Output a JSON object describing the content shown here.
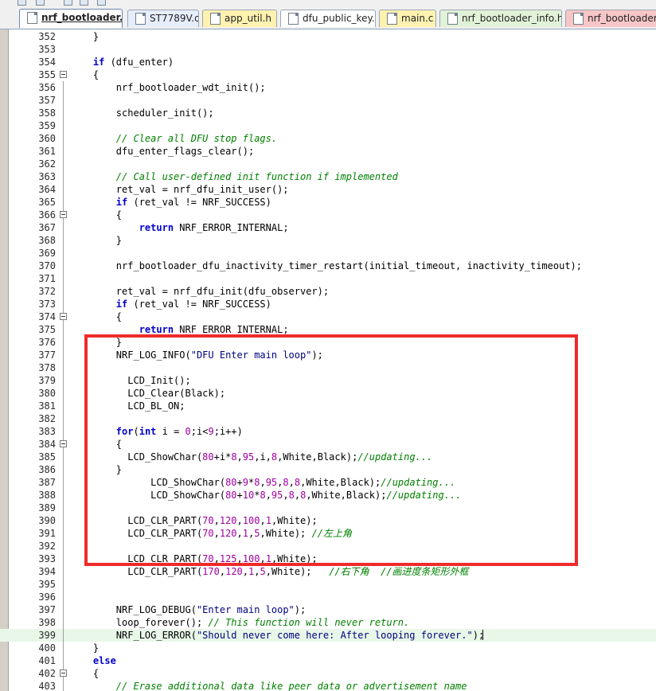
{
  "toolbar": {
    "icons": [
      "build-icon",
      "save-icon",
      "download-icon",
      "debug-icon",
      "check-icon"
    ]
  },
  "tabs": [
    {
      "label": "nrf_bootloader.c*",
      "active": true,
      "color": "#ffffff"
    },
    {
      "label": "ST7789V.c",
      "active": false,
      "color": "#e6eefc"
    },
    {
      "label": "app_util.h",
      "active": false,
      "color": "#fff2b0"
    },
    {
      "label": "dfu_public_key.c",
      "active": false,
      "color": "#ffffff"
    },
    {
      "label": "main.c",
      "active": false,
      "color": "#fff2b0"
    },
    {
      "label": "nrf_bootloader_info.h",
      "active": false,
      "color": "#e2f2d8"
    },
    {
      "label": "nrf_bootloader_a",
      "active": false,
      "color": "#f7c6c6"
    }
  ],
  "editor": {
    "highlighted_line": 399,
    "lines": [
      {
        "n": "352",
        "code": "    }"
      },
      {
        "n": "353",
        "code": ""
      },
      {
        "n": "354",
        "code": "    if (dfu_enter)"
      },
      {
        "n": "355",
        "code": "    {",
        "fold": true
      },
      {
        "n": "356",
        "code": "        nrf_bootloader_wdt_init();"
      },
      {
        "n": "357",
        "code": ""
      },
      {
        "n": "358",
        "code": "        scheduler_init();"
      },
      {
        "n": "359",
        "code": ""
      },
      {
        "n": "360",
        "code": "        // Clear all DFU stop flags."
      },
      {
        "n": "361",
        "code": "        dfu_enter_flags_clear();"
      },
      {
        "n": "362",
        "code": ""
      },
      {
        "n": "363",
        "code": "        // Call user-defined init function if implemented"
      },
      {
        "n": "364",
        "code": "        ret_val = nrf_dfu_init_user();"
      },
      {
        "n": "365",
        "code": "        if (ret_val != NRF_SUCCESS)"
      },
      {
        "n": "366",
        "code": "        {",
        "fold": true
      },
      {
        "n": "367",
        "code": "            return NRF_ERROR_INTERNAL;"
      },
      {
        "n": "368",
        "code": "        }"
      },
      {
        "n": "369",
        "code": ""
      },
      {
        "n": "370",
        "code": "        nrf_bootloader_dfu_inactivity_timer_restart(initial_timeout, inactivity_timeout);"
      },
      {
        "n": "371",
        "code": ""
      },
      {
        "n": "372",
        "code": "        ret_val = nrf_dfu_init(dfu_observer);"
      },
      {
        "n": "373",
        "code": "        if (ret_val != NRF_SUCCESS)"
      },
      {
        "n": "374",
        "code": "        {",
        "fold": true
      },
      {
        "n": "375",
        "code": "            return NRF_ERROR_INTERNAL;"
      },
      {
        "n": "376",
        "code": "        }"
      },
      {
        "n": "377",
        "code": "        NRF_LOG_INFO(\"DFU Enter main loop\");"
      },
      {
        "n": "378",
        "code": ""
      },
      {
        "n": "379",
        "code": "          LCD_Init();"
      },
      {
        "n": "380",
        "code": "          LCD_Clear(Black);"
      },
      {
        "n": "381",
        "code": "          LCD_BL_ON;"
      },
      {
        "n": "382",
        "code": ""
      },
      {
        "n": "383",
        "code": "        for(int i = 0;i<9;i++)"
      },
      {
        "n": "384",
        "code": "        {",
        "fold": true
      },
      {
        "n": "385",
        "code": "          LCD_ShowChar(80+i*8,95,i,8,White,Black);//updating..."
      },
      {
        "n": "386",
        "code": "        }"
      },
      {
        "n": "387",
        "code": "              LCD_ShowChar(80+9*8,95,8,8,White,Black);//updating..."
      },
      {
        "n": "388",
        "code": "              LCD_ShowChar(80+10*8,95,8,8,White,Black);//updating..."
      },
      {
        "n": "389",
        "code": ""
      },
      {
        "n": "390",
        "code": "          LCD_CLR_PART(70,120,100,1,White);"
      },
      {
        "n": "391",
        "code": "          LCD_CLR_PART(70,120,1,5,White); //左上角"
      },
      {
        "n": "392",
        "code": ""
      },
      {
        "n": "393",
        "code": "          LCD_CLR_PART(70,125,100,1,White);"
      },
      {
        "n": "394",
        "code": "          LCD_CLR_PART(170,120,1,5,White);   //右下角  //画进度条矩形外框"
      },
      {
        "n": "395",
        "code": ""
      },
      {
        "n": "396",
        "code": ""
      },
      {
        "n": "397",
        "code": "        NRF_LOG_DEBUG(\"Enter main loop\");"
      },
      {
        "n": "398",
        "code": "        loop_forever(); // This function will never return."
      },
      {
        "n": "399",
        "code": "        NRF_LOG_ERROR(\"Should never come here: After looping forever.\");"
      },
      {
        "n": "400",
        "code": "    }"
      },
      {
        "n": "401",
        "code": "    else"
      },
      {
        "n": "402",
        "code": "    {",
        "fold": true
      },
      {
        "n": "403",
        "code": "        // Erase additional data like peer data or advertisement name"
      }
    ]
  },
  "colors": {
    "keyword": "#0000cc",
    "comment": "#008000",
    "number": "#a000a0",
    "string": "#000080",
    "highlight": "#e8f7e8",
    "annotation_box": "#ee2b2b"
  }
}
